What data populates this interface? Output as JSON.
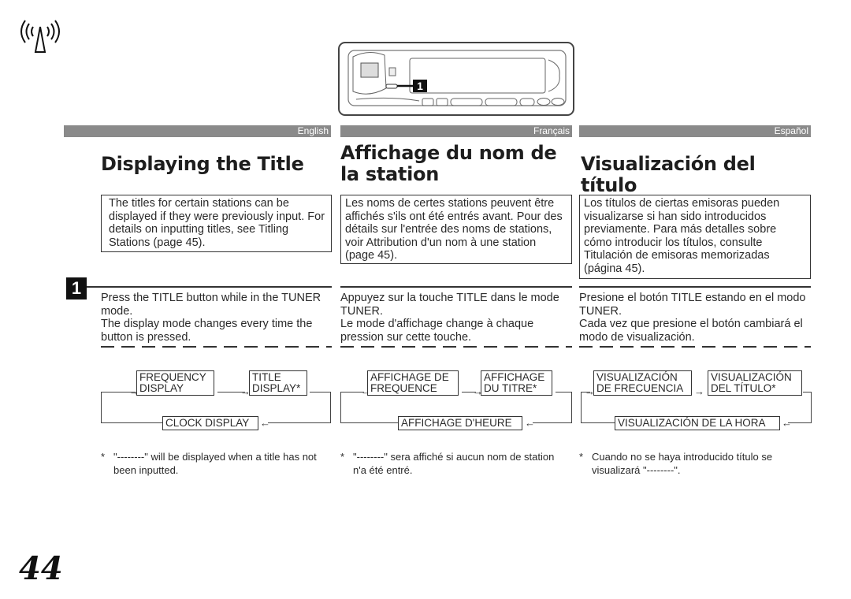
{
  "icons": {
    "tuner": "antenna-broadcast-icon"
  },
  "device_figure": {
    "callout_label": "1"
  },
  "columns": [
    {
      "lang": "English",
      "title": "Displaying the Title",
      "intro": "The titles for certain stations can be displayed if they were previously input. For details on inputting titles, see Titling Stations (page 45).",
      "step1": "Press the TITLE button while in the TUNER mode.",
      "step2": "The display mode changes every time the button is pressed.",
      "diagram": {
        "box1": [
          "FREQUENCY",
          "DISPLAY"
        ],
        "box2": [
          "TITLE",
          "DISPLAY*"
        ],
        "box3": "CLOCK DISPLAY"
      },
      "note_star": "*",
      "note": "\"--------\" will be displayed when a title has not been inputted."
    },
    {
      "lang": "Français",
      "title": "Affichage du nom de la station",
      "intro": "Les noms de certes stations peuvent être affichés s'ils ont été entrés avant. Pour des détails sur l'entrée des noms de stations, voir Attribution d'un nom à une station (page 45).",
      "step1": "Appuyez sur la touche TITLE dans le mode TUNER.",
      "step2": "Le mode d'affichage change à chaque pression sur cette touche.",
      "diagram": {
        "box1": [
          "AFFICHAGE DE",
          "FREQUENCE"
        ],
        "box2": [
          "AFFICHAGE",
          "DU TITRE*"
        ],
        "box3": "AFFICHAGE D'HEURE"
      },
      "note_star": "*",
      "note": "\"--------\" sera affiché si aucun nom de station n'a été entré."
    },
    {
      "lang": "Español",
      "title": "Visualización del título",
      "intro": "Los títulos de ciertas emisoras pueden visualizarse si han sido introducidos previamente. Para más detalles sobre cómo introducir los títulos, consulte Titulación de emisoras memorizadas (página 45).",
      "step1": "Presione el botón TITLE estando en el modo TUNER.",
      "step2": "Cada vez que presione el botón cambiará el modo de visualización.",
      "diagram": {
        "box1": [
          "VISUALIZACIÓN",
          "DE FRECUENCIA"
        ],
        "box2": [
          "VISUALIZACIÓN",
          "DEL TÍTULO*"
        ],
        "box3": "VISUALIZACIÓN DE LA HORA"
      },
      "note_star": "*",
      "note": "Cuando no se haya introducido título se visualizará \"--------\"."
    }
  ],
  "step_number": "1",
  "page_number": "44"
}
